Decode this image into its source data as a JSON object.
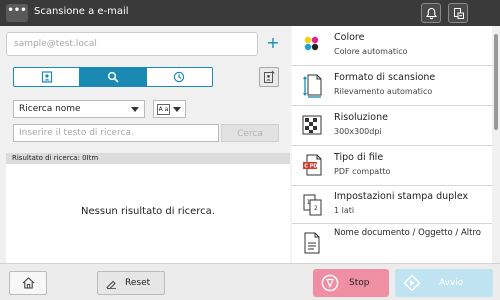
{
  "titlebar": {
    "menu_label": "•••",
    "title": "Scansione a e-mail",
    "icons": [
      "bell-icon",
      "device-status-icon"
    ]
  },
  "destination": {
    "placeholder": "sample@test.local",
    "add_label": "+"
  },
  "search_tabs": [
    "address-book-icon",
    "search-icon",
    "history-clock-icon"
  ],
  "search": {
    "mode_selected": "Ricerca nome",
    "case_button_label": "A a",
    "query_placeholder": "Inserire il testo di ricerca.",
    "search_button_label": "Cerca",
    "result_label": "Risultato di ricerca: 0Itm",
    "no_results_text": "Nessun risultato di ricerca."
  },
  "settings": [
    {
      "title": "Colore",
      "value": "Colore automatico",
      "icon": "color-dots-icon"
    },
    {
      "title": "Formato di scansione",
      "value": "Rilevamento automatico",
      "icon": "scan-size-icon"
    },
    {
      "title": "Risoluzione",
      "value": "300x300dpi",
      "icon": "resolution-icon"
    },
    {
      "title": "Tipo di file",
      "value": "PDF compatto",
      "icon": "pdf-file-icon"
    },
    {
      "title": "Impostazioni stampa duplex",
      "value": "1 lati",
      "icon": "duplex-icon"
    },
    {
      "title": "Nome documento / Oggetto / Altro",
      "value": "",
      "icon": "document-name-icon"
    }
  ],
  "bottom": {
    "reset_label": "Reset",
    "stop_label": "Stop",
    "start_label": "Avvio"
  },
  "colors": {
    "accent": "#1a8ab5",
    "titlebar": "#3a3a3a",
    "stop": "#ef8fa3",
    "start_disabled": "#bfe3f1",
    "pdf_red": "#d23b2c"
  }
}
